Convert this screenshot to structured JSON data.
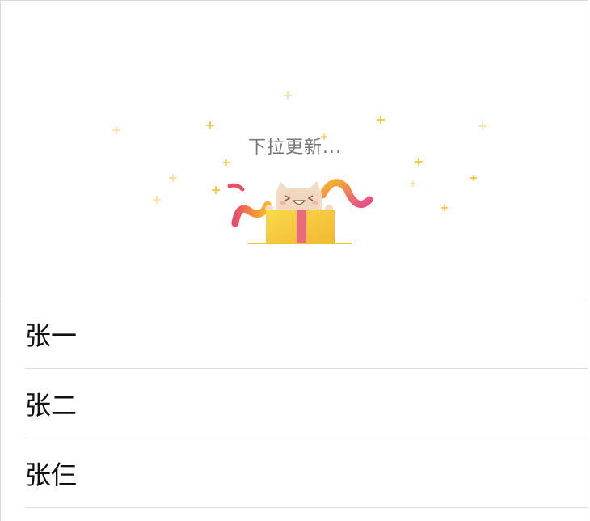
{
  "refresh_header": {
    "status_text": "下拉更新...",
    "colors": {
      "sparkle": "#f2c12e",
      "ribbon_start": "#e84a6e",
      "ribbon_end": "#f5b82a",
      "gift_box": "#f6c93b",
      "gift_band": "#e96a7a",
      "cat": "#f3dcc6"
    }
  },
  "list": {
    "items": [
      {
        "label": "张一"
      },
      {
        "label": "张二"
      },
      {
        "label": "张仨"
      }
    ]
  }
}
